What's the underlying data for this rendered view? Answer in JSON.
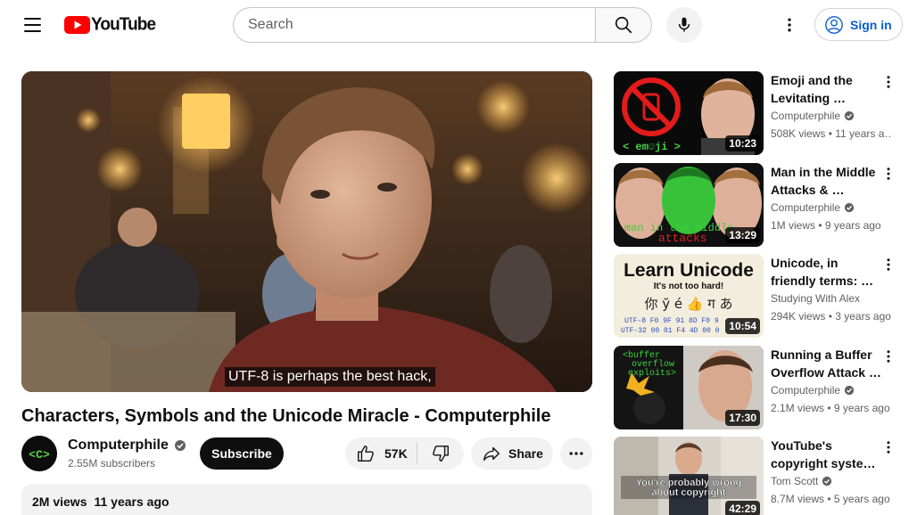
{
  "header": {
    "logo_text": "YouTube",
    "search_placeholder": "Search",
    "sign_in_label": "Sign in"
  },
  "player": {
    "caption": "UTF-8 is perhaps the best hack,"
  },
  "video": {
    "title": "Characters, Symbols and the Unicode Miracle - Computerphile",
    "channel_name": "Computerphile",
    "channel_avatar_text": "<C>",
    "subscribers": "2.55M subscribers",
    "subscribe_label": "Subscribe",
    "likes": "57K",
    "share_label": "Share",
    "views": "2M views",
    "published": "11 years ago"
  },
  "recommendations": [
    {
      "title": "Emoji and the Levitating …",
      "channel": "Computerphile",
      "verified": true,
      "views": "508K views",
      "age": "11 years a…",
      "duration": "10:23",
      "thumb_text": "< em☺ji >"
    },
    {
      "title": "Man in the Middle Attacks & …",
      "channel": "Computerphile",
      "verified": true,
      "views": "1M views",
      "age": "9 years ago",
      "duration": "13:29",
      "thumb_text_1": "man in the middle",
      "thumb_text_2": "attacks"
    },
    {
      "title": "Unicode, in friendly terms: …",
      "channel": "Studying With Alex",
      "verified": false,
      "views": "294K views",
      "age": "3 years ago",
      "duration": "10:54",
      "thumb_title": "Learn Unicode",
      "thumb_subtitle": "It's not too hard!",
      "thumb_glyphs": "你 ў é 👍 ग あ",
      "thumb_row_1": "UTF-8  F0 9F 91 8D F0 9",
      "thumb_row_2": "UTF-32  00 01 F4 4D 00 0"
    },
    {
      "title": "Running a Buffer Overflow Attack …",
      "channel": "Computerphile",
      "verified": true,
      "views": "2.1M views",
      "age": "9 years ago",
      "duration": "17:30",
      "thumb_text_1": "<buffer",
      "thumb_text_2": "overflow",
      "thumb_text_3": "exploits>"
    },
    {
      "title": "YouTube's copyright syste…",
      "channel": "Tom Scott",
      "verified": true,
      "views": "8.7M views",
      "age": "5 years ago",
      "duration": "42:29",
      "thumb_text_1": "You're probably wrong",
      "thumb_text_2": "about copyright"
    }
  ],
  "colors": {
    "brand_red": "#ff0000",
    "link_blue": "#065fd4",
    "chip_gray": "#f2f2f2",
    "text_secondary": "#606060"
  },
  "icons": {
    "menu": "hamburger-icon",
    "search": "search-icon",
    "mic": "mic-icon",
    "more": "more-vert-icon",
    "account": "account-icon",
    "like": "thumbs-up-icon",
    "dislike": "thumbs-down-icon",
    "share": "share-icon",
    "verified": "verified-icon"
  }
}
